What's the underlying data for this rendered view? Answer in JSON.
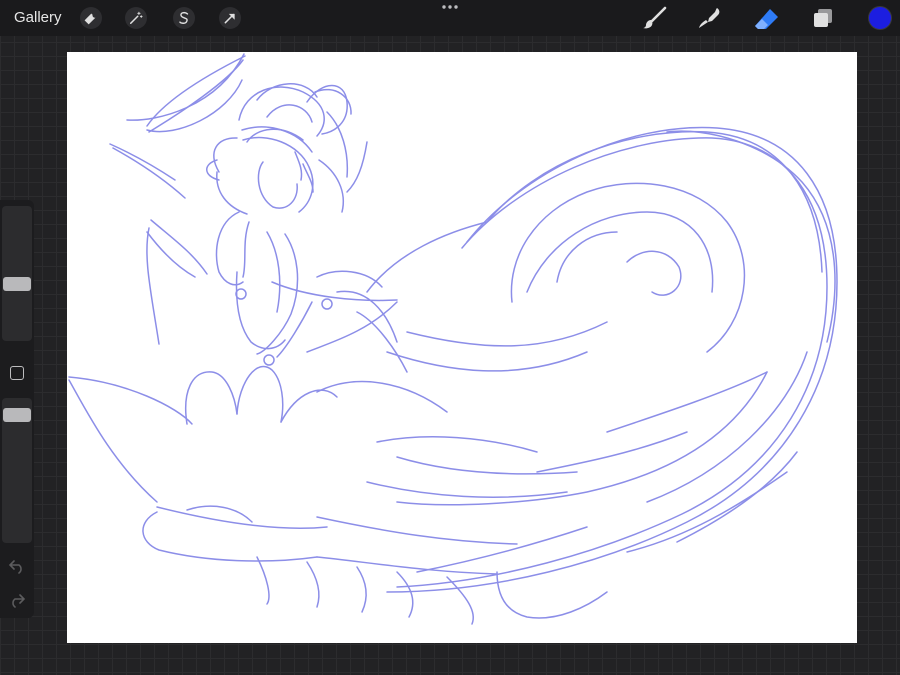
{
  "app": {
    "gallery_label": "Gallery"
  },
  "toolbar": {
    "left_tools": [
      "wrench-icon",
      "magic-wand-icon",
      "selection-icon",
      "transform-arrow-icon"
    ],
    "right_tools": [
      "brush-icon",
      "smudge-icon",
      "eraser-icon",
      "layers-icon"
    ],
    "active_tool": "eraser-icon",
    "active_color": "#1c1ee0",
    "accent_color": "#2e7bf6"
  },
  "sidebar": {
    "brush_size_level": 0.72,
    "opacity_level": 0.78
  },
  "canvas": {
    "background": "#ffffff",
    "sketch_color": "#8c8ee8"
  }
}
